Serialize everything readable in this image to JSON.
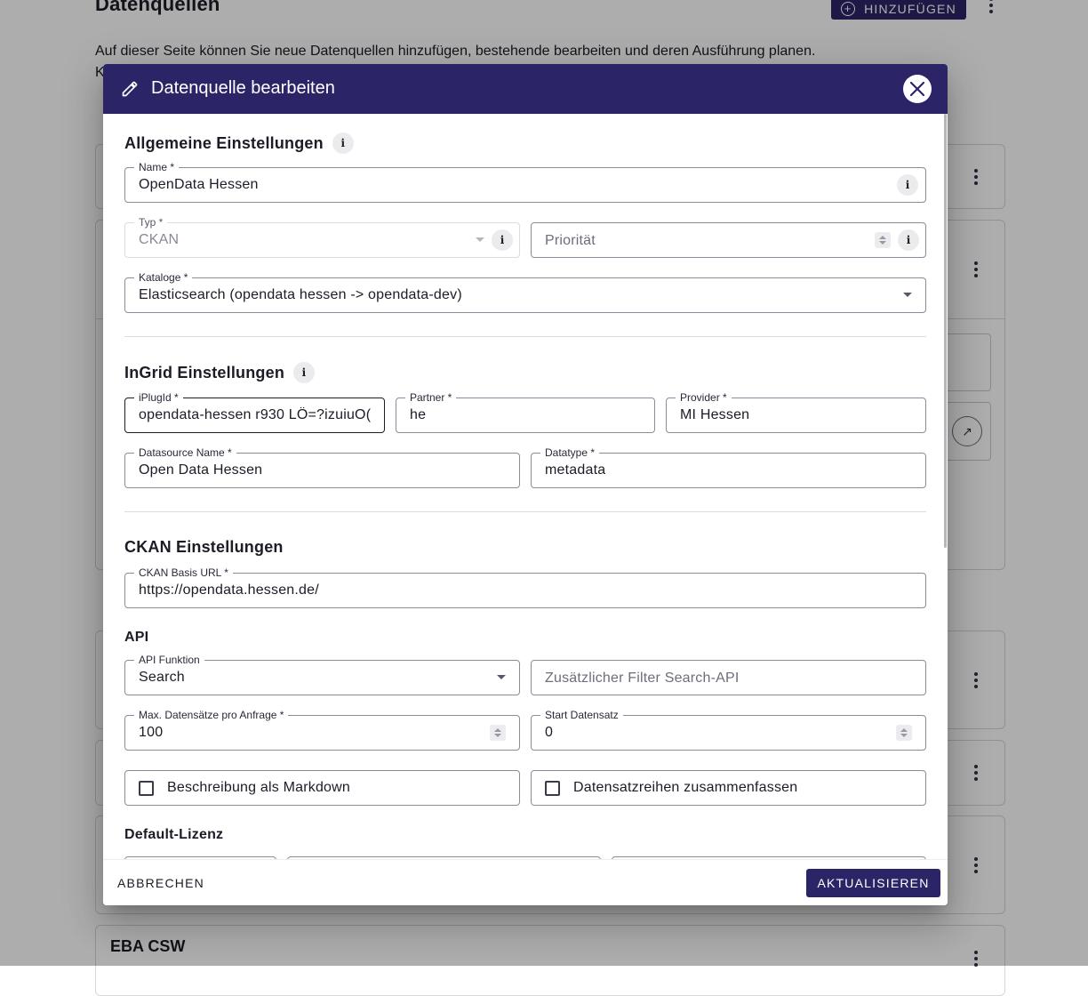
{
  "background": {
    "page_title": "Datenquellen",
    "add_button_label": "HINZUFÜGEN",
    "description": "Auf dieser Seite können Sie neue Datenquellen hinzufügen, bestehende bearbeiten und deren Ausführung planen.",
    "description_line2_fragment": "K",
    "visible_card": {
      "title": "EBA CSW"
    }
  },
  "dialog": {
    "title": "Datenquelle bearbeiten",
    "sections": {
      "general": {
        "title": "Allgemeine Einstellungen",
        "name": {
          "label": "Name *",
          "value": "OpenData Hessen"
        },
        "type": {
          "label": "Typ *",
          "value": "CKAN"
        },
        "priority": {
          "placeholder": "Priorität"
        },
        "catalogs": {
          "label": "Kataloge *",
          "value": "Elasticsearch (opendata hessen -> opendata-dev)"
        }
      },
      "ingrid": {
        "title": "InGrid Einstellungen",
        "iplugid": {
          "label": "iPlugId *",
          "value": "opendata-hessen r930 LÖ=?izuiuO("
        },
        "partner": {
          "label": "Partner *",
          "value": "he"
        },
        "provider": {
          "label": "Provider *",
          "value": "MI Hessen"
        },
        "datasource_name": {
          "label": "Datasource Name *",
          "value": "Open Data Hessen"
        },
        "datatype": {
          "label": "Datatype *",
          "value": "metadata"
        }
      },
      "ckan": {
        "title": "CKAN Einstellungen",
        "base_url": {
          "label": "CKAN Basis URL *",
          "value": "https://opendata.hessen.de/"
        },
        "api_title": "API",
        "api_function": {
          "label": "API Funktion",
          "value": "Search"
        },
        "extra_filter": {
          "placeholder": "Zusätzlicher Filter Search-API"
        },
        "max_records": {
          "label": "Max. Datensätze pro Anfrage *",
          "value": "100"
        },
        "start_record": {
          "label": "Start Datensatz",
          "value": "0"
        },
        "markdown_checkbox": {
          "label": "Beschreibung als Markdown",
          "checked": false
        },
        "merge_checkbox": {
          "label": "Datensatzreihen zusammenfassen",
          "checked": false
        },
        "default_license_title": "Default-Lizenz"
      }
    },
    "footer": {
      "cancel_label": "ABBRECHEN",
      "update_label": "AKTUALISIEREN"
    }
  },
  "colors": {
    "primary": "#2b2467",
    "overlay": "rgba(0,0,0,0.32)"
  }
}
